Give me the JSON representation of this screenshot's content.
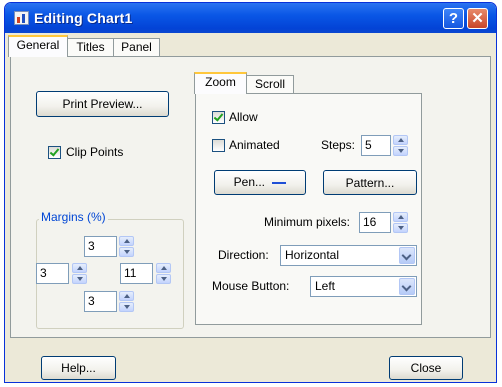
{
  "window": {
    "title": "Editing Chart1",
    "help_glyph": "?",
    "close_glyph": "✕"
  },
  "tabs": [
    "General",
    "Titles",
    "Panel"
  ],
  "general": {
    "print_preview_label": "Print Preview...",
    "clip_points": {
      "label": "Clip Points",
      "checked": true
    },
    "margins": {
      "title": "Margins (%)",
      "top": "3",
      "left": "3",
      "right": "11",
      "bottom": "3"
    }
  },
  "subtabs": [
    "Zoom",
    "Scroll"
  ],
  "zoom": {
    "allow": {
      "label": "Allow",
      "checked": true
    },
    "animated": {
      "label": "Animated",
      "checked": false
    },
    "steps": {
      "label": "Steps:",
      "value": "5"
    },
    "pen_label": "Pen...",
    "pattern_label": "Pattern...",
    "min_pixels": {
      "label": "Minimum pixels:",
      "value": "16"
    },
    "direction": {
      "label": "Direction:",
      "value": "Horizontal"
    },
    "mouse_button": {
      "label": "Mouse Button:",
      "value": "Left"
    }
  },
  "footer": {
    "help_label": "Help...",
    "close_label": "Close"
  },
  "colors": {
    "title_bar": "#0a57e6",
    "pen_swatch": "#1f4fd6",
    "group_title": "#0046d5"
  }
}
